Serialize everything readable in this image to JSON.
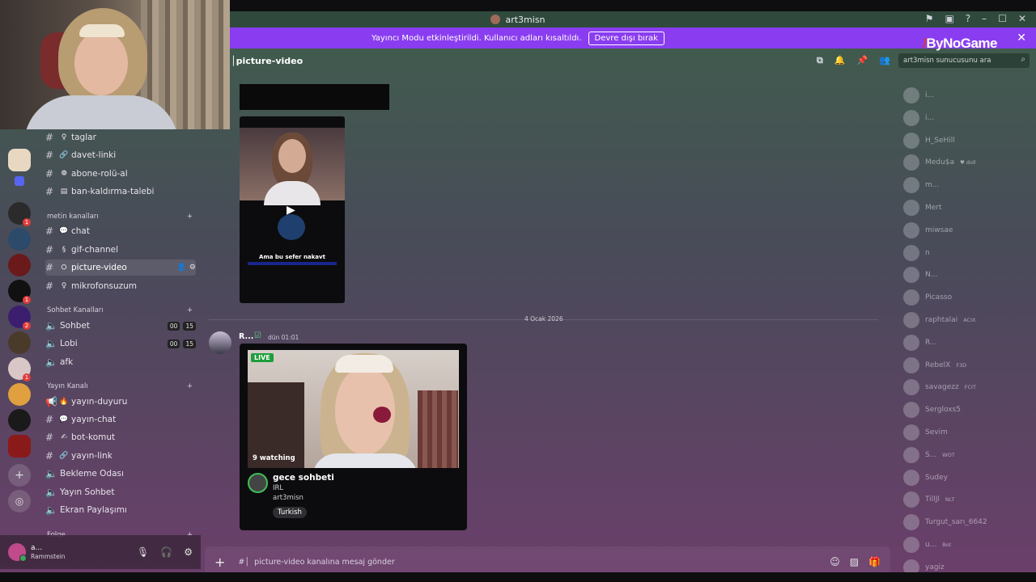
{
  "window": {
    "title": "art3misn"
  },
  "streamer_banner": {
    "text": "Yayıncı Modu etkinleştirildi. Kullanıcı adları kısaltıldı.",
    "button": "Devre dışı bırak"
  },
  "brand": "ByNoGame",
  "channel_header": {
    "name": "picture-video"
  },
  "search": {
    "placeholder": "art3misn sunucusunu ara"
  },
  "sidebar": {
    "top_channels": [
      {
        "name": "taglar",
        "emoji": "♀"
      },
      {
        "name": "davet-linki",
        "emoji": "🔗"
      },
      {
        "name": "abone-rolü-al",
        "emoji": "❁"
      },
      {
        "name": "ban-kaldırma-talebi",
        "emoji": "▤"
      }
    ],
    "cat_text": "metin kanalları",
    "text_channels": [
      {
        "name": "chat",
        "emoji": "💬"
      },
      {
        "name": "gif-channel",
        "emoji": "§"
      },
      {
        "name": "picture-video",
        "emoji": "⛭"
      },
      {
        "name": "mikrofonsuzum",
        "emoji": "♀"
      }
    ],
    "cat_voice": "Sohbet Kanalları",
    "voice_channels": [
      {
        "name": "Sohbet",
        "a": "00",
        "b": "15"
      },
      {
        "name": "Lobi",
        "a": "00",
        "b": "15"
      },
      {
        "name": "afk",
        "a": "",
        "b": ""
      }
    ],
    "cat_stream": "Yayın Kanalı",
    "stream_channels": [
      {
        "name": "yayın-duyuru",
        "emoji": "🔥"
      },
      {
        "name": "yayın-chat",
        "emoji": "💬"
      },
      {
        "name": "bot-komut",
        "emoji": "✍"
      },
      {
        "name": "yayın-link",
        "emoji": "🔗"
      },
      {
        "name": "Bekleme Odası",
        "emoji": ""
      },
      {
        "name": "Yayın Sohbet",
        "emoji": ""
      },
      {
        "name": "Ekran Paylaşımı",
        "emoji": ""
      }
    ],
    "cat_more": "Folge"
  },
  "user": {
    "name": "a...",
    "status": "Rammstein"
  },
  "messages": {
    "video_caption": "Ama bu sefer nakavt",
    "date_divider": "4 Ocak 2026",
    "author": "R...",
    "time": "dün 01:01",
    "embed": {
      "live": "LIVE",
      "watching": "9 watching",
      "title": "gece sohbeti",
      "category": "IRL",
      "streamer": "art3misn",
      "tag": "Turkish"
    }
  },
  "composer": {
    "placeholder": "picture-video kanalına mesaj gönder"
  },
  "members": [
    {
      "name": "i...",
      "tag": ""
    },
    {
      "name": "i...",
      "tag": ""
    },
    {
      "name": "H_SeHill",
      "tag": ""
    },
    {
      "name": "Medu$a",
      "tag": "♥ doll"
    },
    {
      "name": "m...",
      "tag": ""
    },
    {
      "name": "Mert",
      "tag": ""
    },
    {
      "name": "miwsae",
      "tag": ""
    },
    {
      "name": "n",
      "tag": ""
    },
    {
      "name": "N...",
      "tag": ""
    },
    {
      "name": "Picasso",
      "tag": ""
    },
    {
      "name": "raphtalai",
      "tag": "ACIX"
    },
    {
      "name": "R...",
      "tag": ""
    },
    {
      "name": "RebelX",
      "tag": "F3D"
    },
    {
      "name": "savagezz",
      "tag": "FCIT"
    },
    {
      "name": "Sergloxs5",
      "tag": ""
    },
    {
      "name": "Sevim",
      "tag": ""
    },
    {
      "name": "S...",
      "tag": "WOT"
    },
    {
      "name": "Sudey",
      "tag": ""
    },
    {
      "name": "TillJl",
      "tag": "NLT"
    },
    {
      "name": "Turgut_sarı_6642",
      "tag": ""
    },
    {
      "name": "u...",
      "tag": "Bot"
    },
    {
      "name": "yagiz",
      "tag": ""
    }
  ]
}
